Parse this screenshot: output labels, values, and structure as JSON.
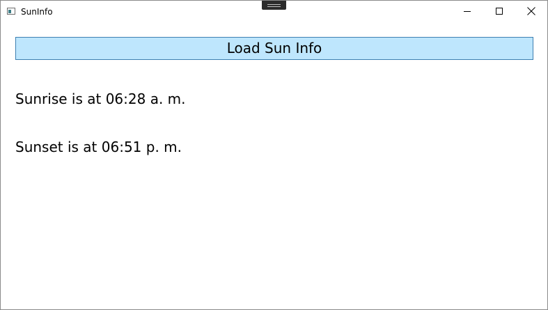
{
  "window": {
    "title": "SunInfo",
    "app_icon": "window-icon"
  },
  "caption_buttons": {
    "minimize_icon": "minimize-icon",
    "maximize_icon": "maximize-icon",
    "close_icon": "close-icon"
  },
  "main": {
    "load_button_label": "Load Sun Info",
    "sunrise_text": "Sunrise is at 06:28 a. m.",
    "sunset_text": "Sunset is at 06:51 p. m."
  },
  "colors": {
    "button_background": "#bee6fd",
    "button_border": "#3c7fb1",
    "window_background": "#ffffff"
  }
}
